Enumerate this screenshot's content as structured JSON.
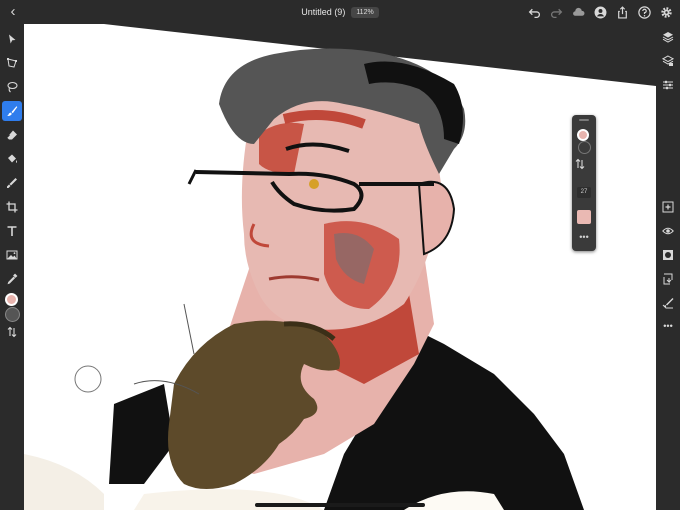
{
  "topbar": {
    "title": "Untitled (9)",
    "zoom": "112%",
    "icons": [
      "back-icon",
      "undo-icon",
      "redo-icon",
      "cloud-icon",
      "account-icon",
      "share-icon",
      "help-icon",
      "settings-icon"
    ]
  },
  "left_toolbar": {
    "tools": [
      "select-icon",
      "transform-icon",
      "lasso-icon",
      "brush-icon",
      "eraser-icon",
      "fill-icon",
      "smudge-icon",
      "crop-icon",
      "text-icon",
      "image-icon",
      "eyedropper-icon"
    ],
    "active_tool": "brush-icon",
    "primary_color": "#e8b4ae",
    "secondary_color": "#555555"
  },
  "right_toolbar": {
    "tools": [
      "layers-icon",
      "layer-stack-icon",
      "adjustments-icon",
      "add-layer-icon",
      "visibility-icon",
      "mask-icon",
      "merge-icon",
      "blend-icon",
      "more-icon"
    ]
  },
  "brush_popup": {
    "color_primary": "#e8b4ae",
    "color_secondary": "#3b3b3b",
    "size": "27",
    "color_swatch": "#eab9b3"
  },
  "colors": {
    "accent": "#2f7ded",
    "chrome": "#2b2b2b",
    "canvas": "#ffffff"
  }
}
